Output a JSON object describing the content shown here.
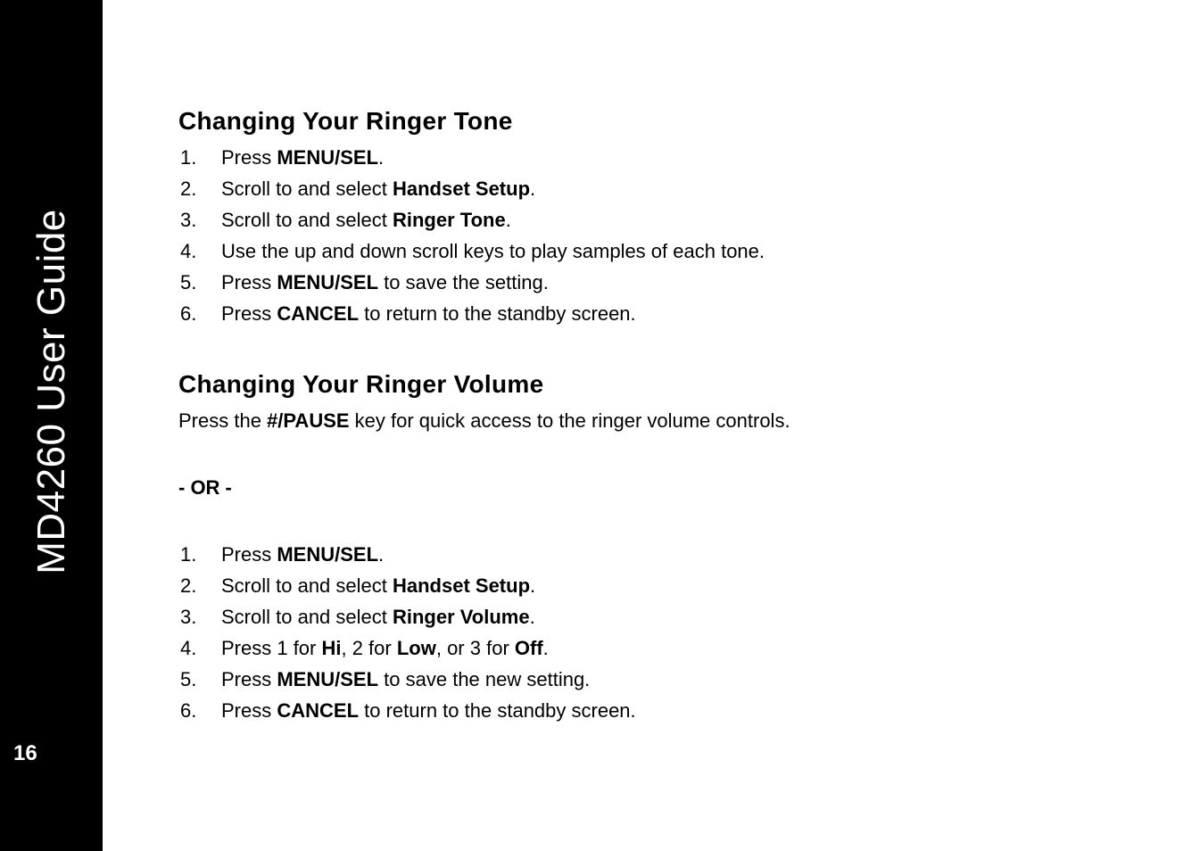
{
  "sidebar": {
    "title": "MD4260 User Guide",
    "pageNumber": "16"
  },
  "section1": {
    "heading": "Changing Your Ringer Tone",
    "items": [
      {
        "num": "1.",
        "pre": "Press ",
        "bold1": "MENU/SEL",
        "post": "."
      },
      {
        "num": "2.",
        "pre": "Scroll to and select ",
        "cond1": "Handset Setup",
        "post": "."
      },
      {
        "num": "3.",
        "pre": "Scroll to and select ",
        "cond1": "Ringer Tone",
        "post": "."
      },
      {
        "num": "4.",
        "pre": "Use the up and down scroll keys to play samples of each tone."
      },
      {
        "num": "5.",
        "pre": "Press ",
        "bold1": "MENU/SEL",
        "post": " to save the setting."
      },
      {
        "num": "6.",
        "pre": "Press ",
        "bold1": "CANCEL",
        "post": " to return to the standby screen."
      }
    ]
  },
  "section2": {
    "heading": "Changing Your Ringer Volume",
    "intro_pre": "Press the ",
    "intro_bold": "#/PAUSE",
    "intro_post": " key for quick access to the ringer volume controls.",
    "or": "- OR -",
    "items": [
      {
        "num": "1.",
        "pre": "Press ",
        "bold1": "MENU/SEL",
        "post": "."
      },
      {
        "num": "2.",
        "pre": "Scroll to and select ",
        "cond1": "Handset Setup",
        "post": "."
      },
      {
        "num": "3.",
        "pre": "Scroll to and select ",
        "cond1": "Ringer Volume",
        "post": "."
      },
      {
        "num": "4.",
        "pre": "Press 1 for ",
        "cond1": "Hi",
        "mid1": ", 2 for ",
        "cond2": "Low",
        "mid2": ", or 3 for ",
        "cond3": "Off",
        "post": "."
      },
      {
        "num": "5.",
        "pre": "Press ",
        "bold1": "MENU/SEL",
        "post": " to save the new setting."
      },
      {
        "num": "6.",
        "pre": "Press ",
        "bold1": "CANCEL",
        "post": " to return to the standby screen."
      }
    ]
  }
}
